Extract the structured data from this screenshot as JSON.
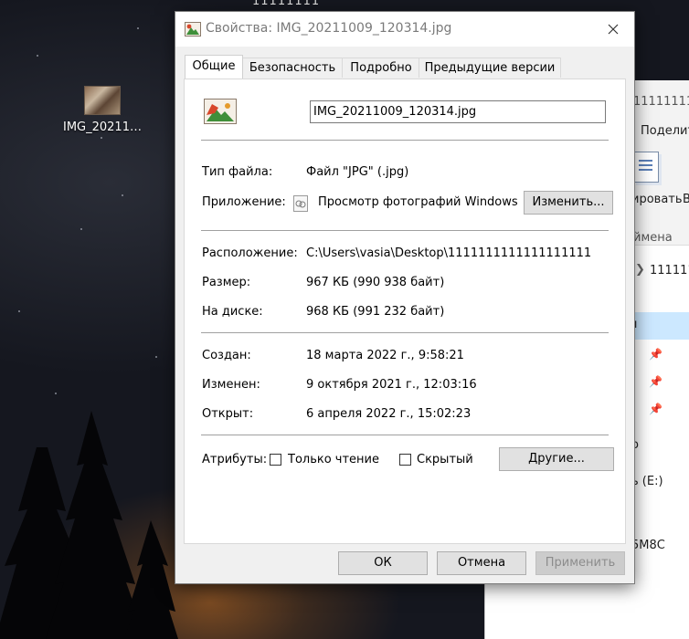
{
  "desktop": {
    "top_text": "11111111",
    "icon_label": "IMG_20211…"
  },
  "explorer": {
    "title_fragment": "1111111111",
    "share_label": "Поделит",
    "copy_label": "ировать",
    "copy_label2": "В",
    "cancel_label": "ймена",
    "path_fragment": "111111",
    "selected_item": "л",
    "item_o": "о",
    "drive_label": "ь (E:)",
    "item_code": "5M8C"
  },
  "dialog": {
    "title": "Свойства: IMG_20211009_120314.jpg",
    "tabs": [
      "Общие",
      "Безопасность",
      "Подробно",
      "Предыдущие версии"
    ],
    "file_name": "IMG_20211009_120314.jpg",
    "general": {
      "file_type_label": "Тип файла:",
      "file_type_value": "Файл \"JPG\" (.jpg)",
      "app_label": "Приложение:",
      "app_value": "Просмотр фотографий Windows",
      "change_button": "Изменить...",
      "location_label": "Расположение:",
      "location_value": "C:\\Users\\vasia\\Desktop\\1111111111111111111",
      "size_label": "Размер:",
      "size_value": "967 КБ (990 938 байт)",
      "disk_label": "На диске:",
      "disk_value": "968 КБ (991 232 байт)",
      "created_label": "Создан:",
      "created_value": "18 марта 2022 г., 9:58:21",
      "modified_label": "Изменен:",
      "modified_value": "9 октября 2021 г., 12:03:16",
      "opened_label": "Открыт:",
      "opened_value": "6 апреля 2022 г., 15:02:23",
      "attributes_label": "Атрибуты:",
      "readonly_label": "Только чтение",
      "readonly_checked": false,
      "hidden_label": "Скрытый",
      "hidden_checked": false,
      "other_button": "Другие..."
    },
    "buttons": {
      "ok": "ОК",
      "cancel": "Отмена",
      "apply": "Применить"
    }
  }
}
